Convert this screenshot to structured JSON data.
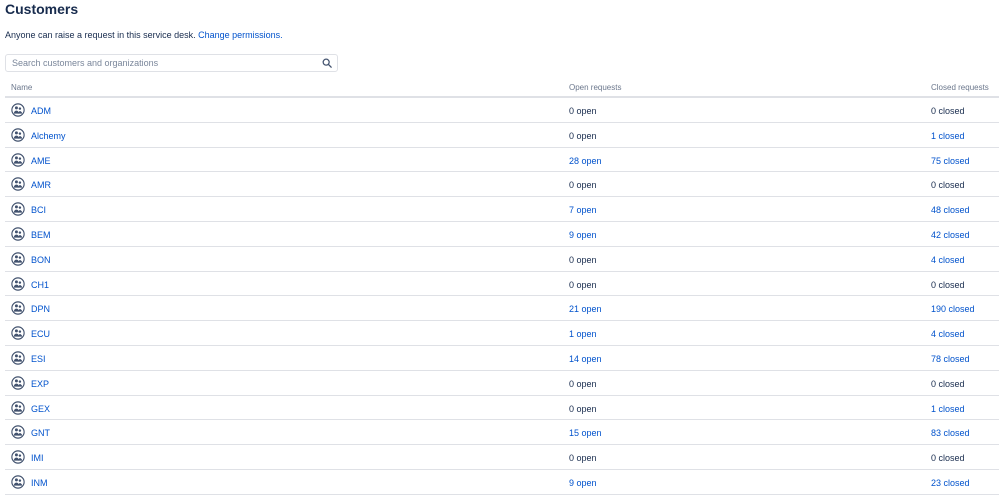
{
  "page": {
    "title": "Customers",
    "description_text": "Anyone can raise a request in this service desk.",
    "description_link": "Change permissions."
  },
  "search": {
    "placeholder": "Search customers and organizations",
    "value": ""
  },
  "icons": {
    "search": "search-icon",
    "organization": "organization-icon"
  },
  "colors": {
    "link": "#0052cc",
    "text": "#172b4d",
    "muted": "#6b778c",
    "divider": "#dfe1e6"
  },
  "table": {
    "columns": [
      "Name",
      "Open requests",
      "Closed requests"
    ],
    "rows": [
      {
        "name": "ADM",
        "open": "0 open",
        "closed": "0 closed",
        "open_link": false,
        "closed_link": false
      },
      {
        "name": "Alchemy",
        "open": "0 open",
        "closed": "1 closed",
        "open_link": false,
        "closed_link": true
      },
      {
        "name": "AME",
        "open": "28 open",
        "closed": "75 closed",
        "open_link": true,
        "closed_link": true
      },
      {
        "name": "AMR",
        "open": "0 open",
        "closed": "0 closed",
        "open_link": false,
        "closed_link": false
      },
      {
        "name": "BCI",
        "open": "7 open",
        "closed": "48 closed",
        "open_link": true,
        "closed_link": true
      },
      {
        "name": "BEM",
        "open": "9 open",
        "closed": "42 closed",
        "open_link": true,
        "closed_link": true
      },
      {
        "name": "BON",
        "open": "0 open",
        "closed": "4 closed",
        "open_link": false,
        "closed_link": true
      },
      {
        "name": "CH1",
        "open": "0 open",
        "closed": "0 closed",
        "open_link": false,
        "closed_link": false
      },
      {
        "name": "DPN",
        "open": "21 open",
        "closed": "190 closed",
        "open_link": true,
        "closed_link": true
      },
      {
        "name": "ECU",
        "open": "1 open",
        "closed": "4 closed",
        "open_link": true,
        "closed_link": true
      },
      {
        "name": "ESI",
        "open": "14 open",
        "closed": "78 closed",
        "open_link": true,
        "closed_link": true
      },
      {
        "name": "EXP",
        "open": "0 open",
        "closed": "0 closed",
        "open_link": false,
        "closed_link": false
      },
      {
        "name": "GEX",
        "open": "0 open",
        "closed": "1 closed",
        "open_link": false,
        "closed_link": true
      },
      {
        "name": "GNT",
        "open": "15 open",
        "closed": "83 closed",
        "open_link": true,
        "closed_link": true
      },
      {
        "name": "IMI",
        "open": "0 open",
        "closed": "0 closed",
        "open_link": false,
        "closed_link": false
      },
      {
        "name": "INM",
        "open": "9 open",
        "closed": "23 closed",
        "open_link": true,
        "closed_link": true
      }
    ]
  }
}
